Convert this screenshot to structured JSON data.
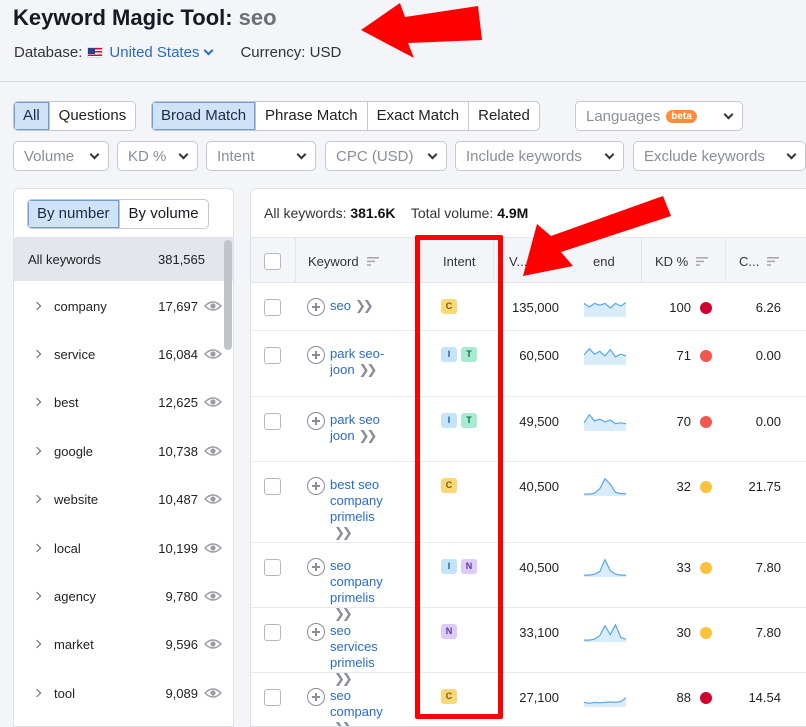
{
  "header": {
    "title": "Keyword Magic Tool:",
    "query": "seo",
    "database_label": "Database:",
    "database_value": "United States",
    "currency": "Currency: USD"
  },
  "match_tabs": [
    "All",
    "Questions",
    "Broad Match",
    "Phrase Match",
    "Exact Match",
    "Related"
  ],
  "languages": {
    "label": "Languages",
    "badge": "beta"
  },
  "filters": [
    "Volume",
    "KD %",
    "Intent",
    "CPC (USD)",
    "Include keywords",
    "Exclude keywords"
  ],
  "sidebar": {
    "toggle": [
      "By number",
      "By volume"
    ],
    "all_label": "All keywords",
    "all_count": "381,565",
    "groups": [
      {
        "name": "company",
        "count": "17,697"
      },
      {
        "name": "service",
        "count": "16,084"
      },
      {
        "name": "best",
        "count": "12,625"
      },
      {
        "name": "google",
        "count": "10,738"
      },
      {
        "name": "website",
        "count": "10,487"
      },
      {
        "name": "local",
        "count": "10,199"
      },
      {
        "name": "agency",
        "count": "9,780"
      },
      {
        "name": "market",
        "count": "9,596"
      },
      {
        "name": "tool",
        "count": "9,089"
      }
    ]
  },
  "summary": {
    "all_label": "All keywords:",
    "all_value": "381.6K",
    "total_label": "Total volume:",
    "total_value": "4.9M"
  },
  "columns": {
    "keyword": "Keyword",
    "intent": "Intent",
    "volume": "V...",
    "trend": "end",
    "kd": "KD %",
    "cpc": "C..."
  },
  "rows": [
    {
      "keyword": "seo",
      "intents": [
        "C"
      ],
      "volume": "135,000",
      "kd": "100",
      "kd_color": "#d2002c",
      "cpc": "6.26",
      "trend": [
        0.7,
        0.5,
        0.7,
        0.6,
        0.7,
        0.45,
        0.7,
        0.55,
        0.75
      ]
    },
    {
      "keyword": "park seo-joon",
      "intents": [
        "I",
        "T"
      ],
      "volume": "60,500",
      "kd": "71",
      "kd_color": "#f2564d",
      "cpc": "0.00",
      "trend": [
        0.5,
        0.85,
        0.55,
        0.7,
        0.45,
        0.8,
        0.4,
        0.55,
        0.45
      ]
    },
    {
      "keyword": "park seo joon",
      "intents": [
        "I",
        "T"
      ],
      "volume": "49,500",
      "kd": "70",
      "kd_color": "#f2564d",
      "cpc": "0.00",
      "trend": [
        0.4,
        0.85,
        0.5,
        0.6,
        0.45,
        0.55,
        0.35,
        0.4,
        0.35
      ]
    },
    {
      "keyword": "best seo company primelis",
      "intents": [
        "C"
      ],
      "volume": "40,500",
      "kd": "32",
      "kd_color": "#f9c23c",
      "cpc": "21.75",
      "trend": [
        0.05,
        0.05,
        0.1,
        0.35,
        0.9,
        0.6,
        0.15,
        0.08,
        0.08
      ]
    },
    {
      "keyword": "seo company primelis",
      "intents": [
        "I",
        "N"
      ],
      "volume": "40,500",
      "kd": "33",
      "kd_color": "#f9c23c",
      "cpc": "7.80",
      "trend": [
        0.05,
        0.05,
        0.1,
        0.25,
        0.9,
        0.3,
        0.1,
        0.05,
        0.05
      ]
    },
    {
      "keyword": "seo services primelis",
      "intents": [
        "N"
      ],
      "volume": "33,100",
      "kd": "30",
      "kd_color": "#f9c23c",
      "cpc": "7.80",
      "trend": [
        0.05,
        0.05,
        0.1,
        0.3,
        0.85,
        0.35,
        0.9,
        0.2,
        0.1
      ]
    },
    {
      "keyword": "seo company",
      "intents": [
        "C"
      ],
      "volume": "27,100",
      "kd": "88",
      "kd_color": "#d2002c",
      "cpc": "14.54",
      "trend": [
        0.2,
        0.15,
        0.2,
        0.18,
        0.2,
        0.22,
        0.2,
        0.25,
        0.45
      ]
    }
  ]
}
